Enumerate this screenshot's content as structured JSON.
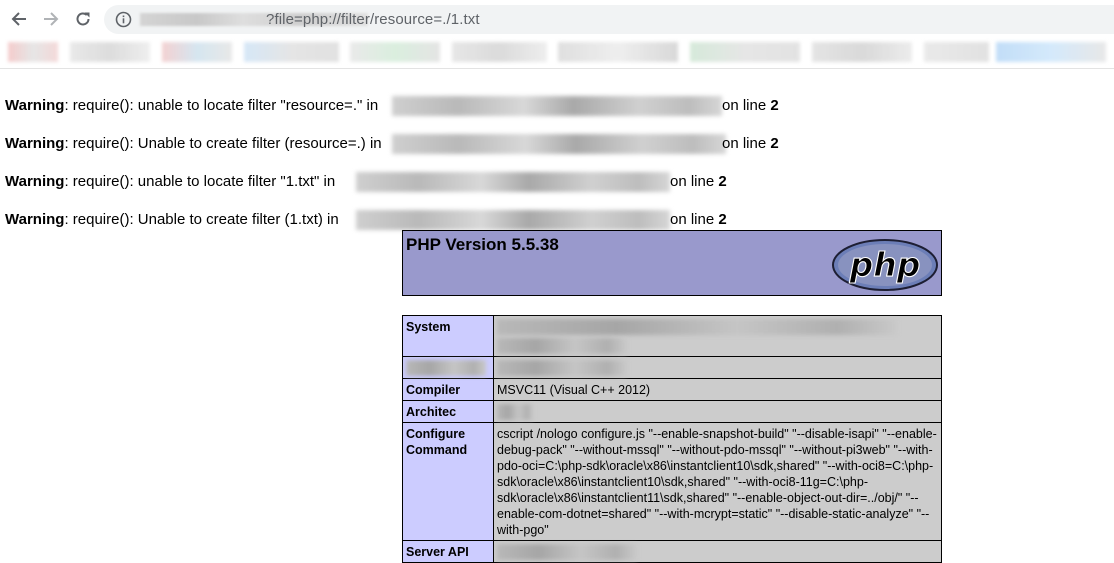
{
  "browser": {
    "url_suffix": "?file=php://filter/resource=./1.txt"
  },
  "warnings": [
    {
      "label": "Warning",
      "text": ": require(): unable to locate filter \"resource=.\" in",
      "suffix_label": "on line",
      "line": "2"
    },
    {
      "label": "Warning",
      "text": ": require(): Unable to create filter (resource=.) in",
      "suffix_label": "on line",
      "line": "2"
    },
    {
      "label": "Warning",
      "text": ": require(): unable to locate filter \"1.txt\" in",
      "suffix_label": "on line",
      "line": "2"
    },
    {
      "label": "Warning",
      "text": ": require(): Unable to create filter (1.txt) in",
      "suffix_label": "on line",
      "line": "2"
    }
  ],
  "phpinfo": {
    "title": "PHP Version 5.5.38",
    "logo_text": "php",
    "rows": [
      {
        "key": "System",
        "value": ""
      },
      {
        "key": "",
        "value": ""
      },
      {
        "key": "Compiler",
        "value": "MSVC11 (Visual C++ 2012)"
      },
      {
        "key": "Architec",
        "value": ""
      },
      {
        "key": "Configure Command",
        "value": "cscript /nologo configure.js \"--enable-snapshot-build\" \"--disable-isapi\" \"--enable-debug-pack\" \"--without-mssql\" \"--without-pdo-mssql\" \"--without-pi3web\" \"--with-pdo-oci=C:\\php-sdk\\oracle\\x86\\instantclient10\\sdk,shared\" \"--with-oci8=C:\\php-sdk\\oracle\\x86\\instantclient10\\sdk,shared\" \"--with-oci8-11g=C:\\php-sdk\\oracle\\x86\\instantclient11\\sdk,shared\" \"--enable-object-out-dir=../obj/\" \"--enable-com-dotnet=shared\" \"--with-mcrypt=static\" \"--disable-static-analyze\" \"--with-pgo\""
      },
      {
        "key": "Server API",
        "value": ""
      }
    ]
  },
  "colors": {
    "php_header_bg": "#9999cc",
    "php_key_bg": "#ccccff",
    "php_value_bg": "#cccccc"
  }
}
